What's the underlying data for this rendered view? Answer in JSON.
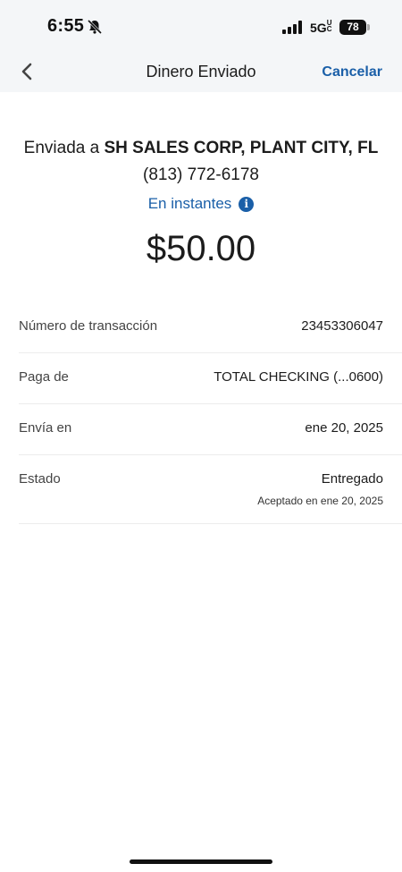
{
  "status_bar": {
    "time": "6:55",
    "network": "5G",
    "network_sub": "UC",
    "battery": "78"
  },
  "nav": {
    "title": "Dinero Enviado",
    "cancel_label": "Cancelar"
  },
  "summary": {
    "sent_to_prefix": "Enviada a ",
    "recipient_name": "SH SALES CORP, PLANT CITY, FL",
    "recipient_phone": "(813) 772-6178",
    "speed_label": "En instantes",
    "amount": "$50.00"
  },
  "details": [
    {
      "label": "Número de transacción",
      "value": "23453306047"
    },
    {
      "label": "Paga de",
      "value": "TOTAL CHECKING (...0600)"
    },
    {
      "label": "Envía en",
      "value": "ene 20, 2025"
    },
    {
      "label": "Estado",
      "value": "Entregado",
      "sub": "Aceptado en ene 20, 2025"
    }
  ],
  "colors": {
    "accent": "#1a5fa8",
    "header_bg": "#f4f6f8"
  }
}
